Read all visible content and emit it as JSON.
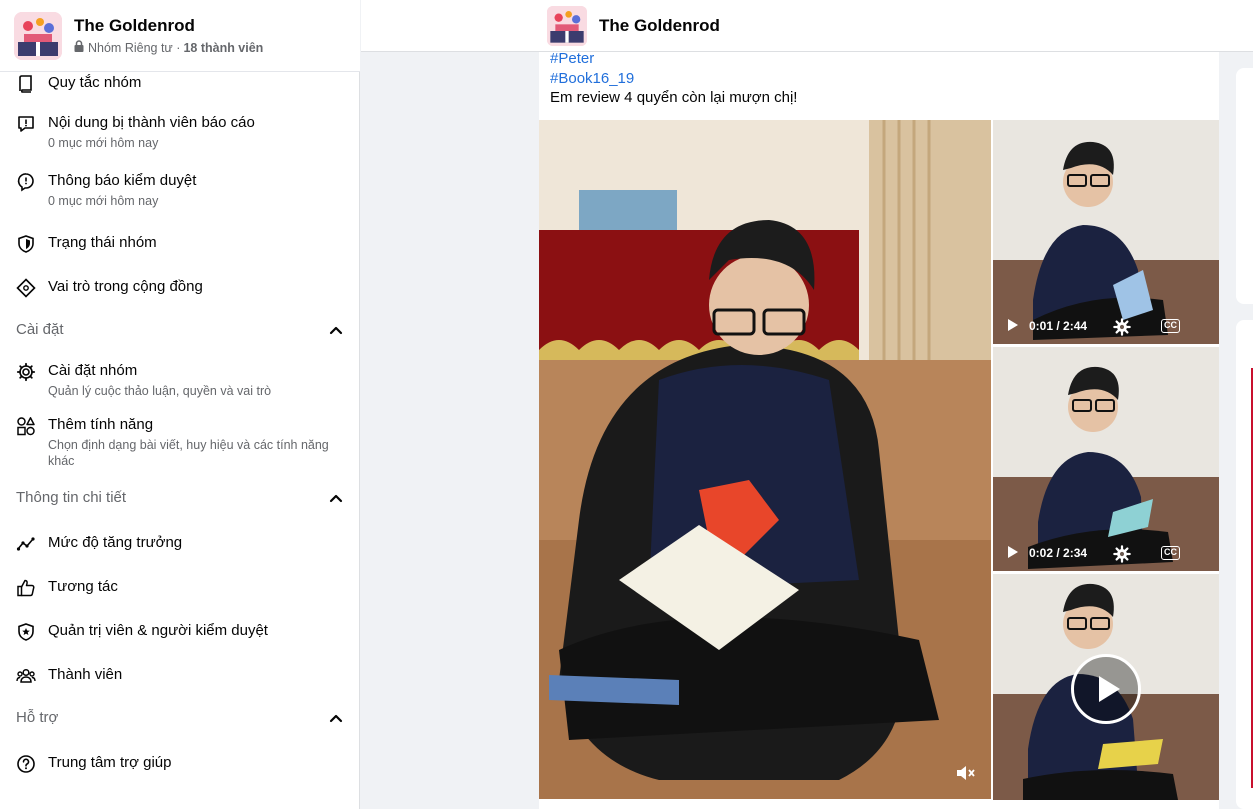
{
  "group": {
    "name": "The Goldenrod",
    "privacy": "Nhóm Riêng tư ·",
    "members": "18 thành viên"
  },
  "sidebar": {
    "items_top": [
      {
        "label": "Quy tắc nhóm",
        "icon": "book-icon"
      },
      {
        "label": "Nội dung bị thành viên báo cáo",
        "desc": "0 mục mới hôm nay",
        "icon": "report-icon"
      },
      {
        "label": "Thông báo kiểm duyệt",
        "desc": "0 mục mới hôm nay",
        "icon": "moderation-alert-icon"
      },
      {
        "label": "Trạng thái nhóm",
        "icon": "shield-icon"
      },
      {
        "label": "Vai trò trong cộng đồng",
        "icon": "diamond-icon"
      }
    ],
    "sections": {
      "settings": {
        "title": "Cài đặt",
        "items": [
          {
            "label": "Cài đặt nhóm",
            "desc": "Quản lý cuộc thảo luận, quyền và vai trò",
            "icon": "gear-icon"
          },
          {
            "label": "Thêm tính năng",
            "desc": "Chọn định dạng bài viết, huy hiệu và các tính năng khác",
            "icon": "shapes-icon"
          }
        ]
      },
      "insights": {
        "title": "Thông tin chi tiết",
        "items": [
          {
            "label": "Mức độ tăng trưởng",
            "icon": "growth-chart-icon"
          },
          {
            "label": "Tương tác",
            "icon": "thumbs-up-icon"
          },
          {
            "label": "Quản trị viên & người kiểm duyệt",
            "icon": "star-shield-icon"
          },
          {
            "label": "Thành viên",
            "icon": "people-icon"
          }
        ]
      },
      "support": {
        "title": "Hỗ trợ",
        "items": [
          {
            "label": "Trung tâm trợ giúp",
            "icon": "help-icon"
          }
        ]
      }
    }
  },
  "post": {
    "hashtags": [
      "#Peter",
      "#Book16_19"
    ],
    "text": "Em review 4 quyển còn lại mượn chị!",
    "videos": [
      {
        "time": "0:01 / 2:44"
      },
      {
        "time": "0:02 / 2:34"
      }
    ],
    "cc_label": "CC"
  },
  "colors": {
    "accent_link": "#216fdb",
    "secondary_text": "#65676b",
    "page_bg": "#f0f2f5"
  }
}
